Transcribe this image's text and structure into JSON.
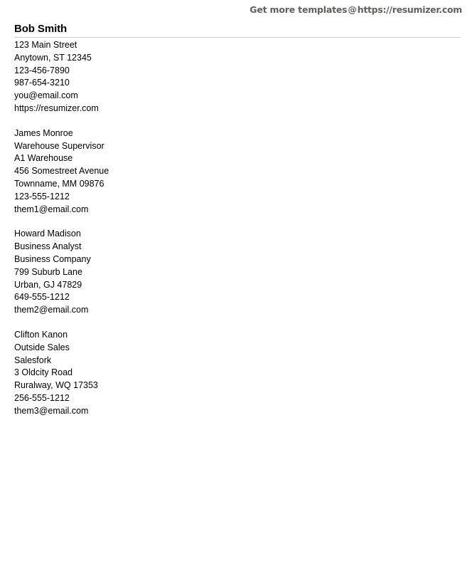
{
  "promo": {
    "lead": "Get more templates",
    "at": "@",
    "url": "https://resumizer.com"
  },
  "document": {
    "name": "Bob Smith",
    "contact": [
      "123 Main Street",
      "Anytown, ST 12345",
      "123-456-7890",
      "987-654-3210",
      "you@email.com",
      "https://resumizer.com"
    ],
    "references": [
      {
        "lines": [
          "James Monroe",
          "Warehouse Supervisor",
          "A1 Warehouse",
          "456 Somestreet Avenue",
          "Townname, MM 09876",
          "123-555-1212",
          "them1@email.com"
        ]
      },
      {
        "lines": [
          "Howard Madison",
          "Business Analyst",
          "Business Company",
          "799 Suburb Lane",
          "Urban, GJ 47829",
          "649-555-1212",
          "them2@email.com"
        ]
      },
      {
        "lines": [
          "Clifton Kanon",
          "Outside Sales",
          "Salesfork",
          "3 Oldcity Road",
          "Ruralway, WQ 17353",
          "256-555-1212",
          "them3@email.com"
        ]
      }
    ]
  },
  "colors": {
    "promo_text": "#5c6359",
    "rule": "#cccccc",
    "body_text": "#000000",
    "page_background": "#ffffff"
  }
}
